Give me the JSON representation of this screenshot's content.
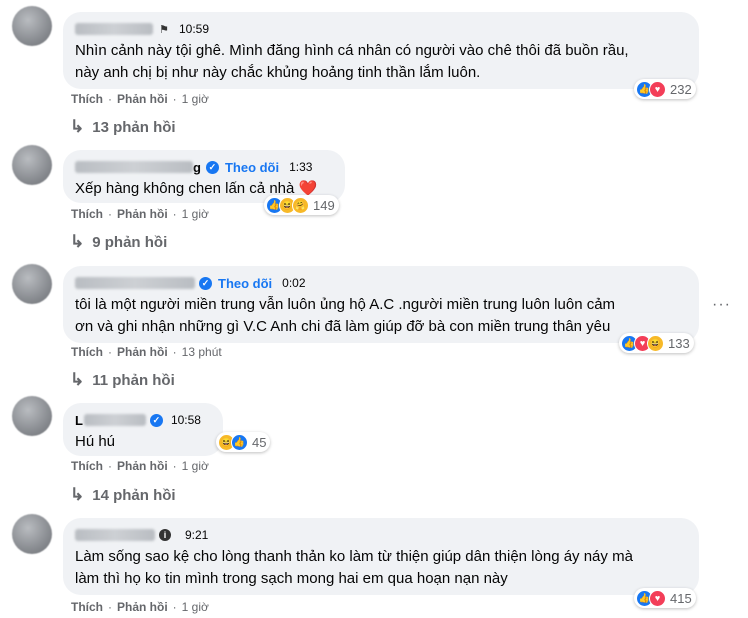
{
  "comments": [
    {
      "badge": "flag-icon",
      "follow": "",
      "time": "10:59",
      "text": "Nhìn cảnh này tội ghê. Mình đăng hình cá nhân có người vào chê thôi đã buồn rầu,\nnày anh chị bị như này chắc khủng hoảng tinh thần lắm luôn.",
      "like": "Thích",
      "reply": "Phản hồi",
      "ago": "1 giờ",
      "reactions": [
        "like-icon",
        "love-icon"
      ],
      "reaction_count": "232",
      "replies": "13 phản hồi"
    },
    {
      "name_tail": "g",
      "badge": "verified-icon",
      "follow": "Theo dõi",
      "time": "1:33",
      "text": "Xếp hàng không chen lấn cả nhà ❤️",
      "like": "Thích",
      "reply": "Phản hồi",
      "ago": "1 giờ",
      "reactions": [
        "like-icon",
        "haha-icon",
        "care-icon"
      ],
      "reaction_count": "149",
      "replies": "9 phản hồi"
    },
    {
      "badge": "verified-icon",
      "follow": "Theo dõi",
      "time": "0:02",
      "text": "tôi là một người miền trung vẫn luôn ủng hộ A.C .người miền trung luôn luôn cảm\nơn và ghi nhận những gì V.C Anh chi đã làm giúp đỡ bà con miền trung thân yêu",
      "like": "Thích",
      "reply": "Phản hồi",
      "ago": "13 phút",
      "reactions": [
        "like-icon",
        "love-icon",
        "haha-icon"
      ],
      "reaction_count": "133",
      "replies": "11 phản hồi"
    },
    {
      "name_initial": "L",
      "badge": "verified-icon",
      "follow": "",
      "time": "10:58",
      "text": "Hú hú",
      "like": "Thích",
      "reply": "Phản hồi",
      "ago": "1 giờ",
      "reactions": [
        "haha-icon",
        "like-icon"
      ],
      "reaction_count": "45",
      "replies": "14 phản hồi"
    },
    {
      "badge": "info-icon",
      "follow": "",
      "time": "9:21",
      "text": "Làm sống sao kệ cho lòng thanh thản ko làm từ thiện giúp dân thiện lòng áy náy mà\nlàm thì họ ko tin mình trong sạch mong hai em qua hoạn nạn này",
      "like": "Thích",
      "reply": "Phản hồi",
      "ago": "1 giờ",
      "reactions": [
        "like-icon",
        "love-icon"
      ],
      "reaction_count": "415",
      "replies": ""
    }
  ],
  "more_menu": "···",
  "reaction_glyphs": {
    "like-icon": "👍",
    "love-icon": "♥",
    "haha-icon": "😆",
    "care-icon": "🤗"
  },
  "colors": {
    "bubble": "#f0f2f5",
    "follow": "#1877f2",
    "meta": "#65676b",
    "like": "#1877f2",
    "love": "#f33e58",
    "haha": "#f7b928"
  }
}
